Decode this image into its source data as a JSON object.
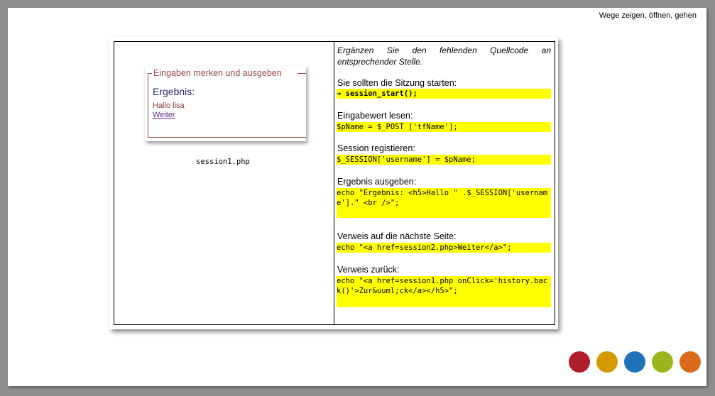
{
  "header": {
    "tagline": "Wege zeigen, öffnen, gehen"
  },
  "demo": {
    "legend": "Eingaben merken und ausgeben",
    "result_title": "Ergebnis:",
    "result_text": "Hallo lisa",
    "link_label": "Weiter",
    "caption": "session1.php"
  },
  "task": {
    "intro": "Ergänzen Sie den fehlenden Quellcode an entsprechender Stelle.",
    "steps": [
      {
        "label": "Sie sollten die Sitzung starten:",
        "code": "→ session_start();"
      },
      {
        "label": "Eingabewert lesen:",
        "code": "$pName = $_POST ['tfName'];"
      },
      {
        "label": "Session registieren:",
        "code": "$_SESSION['username'] = $pName;"
      },
      {
        "label": "Ergebnis ausgeben:",
        "code": "echo \"Ergebnis: <h5>Hallo \" .$_SESSION['username'].\" <br />\";"
      },
      {
        "label": "Verweis auf die nächste Seite:",
        "code": "echo \"<a href=session2.php>Weiter</a>\";"
      },
      {
        "label": "Verweis zurück:",
        "code": "echo \"<a href=session1.php onClick='history.back()'>Zur&uuml;ck</a></h5>\";"
      }
    ]
  },
  "colors": {
    "dot1": "#b01e2c",
    "dot2": "#d39a00",
    "dot3": "#1f72b8",
    "dot4": "#9bb51c",
    "dot5": "#d96a1b"
  }
}
